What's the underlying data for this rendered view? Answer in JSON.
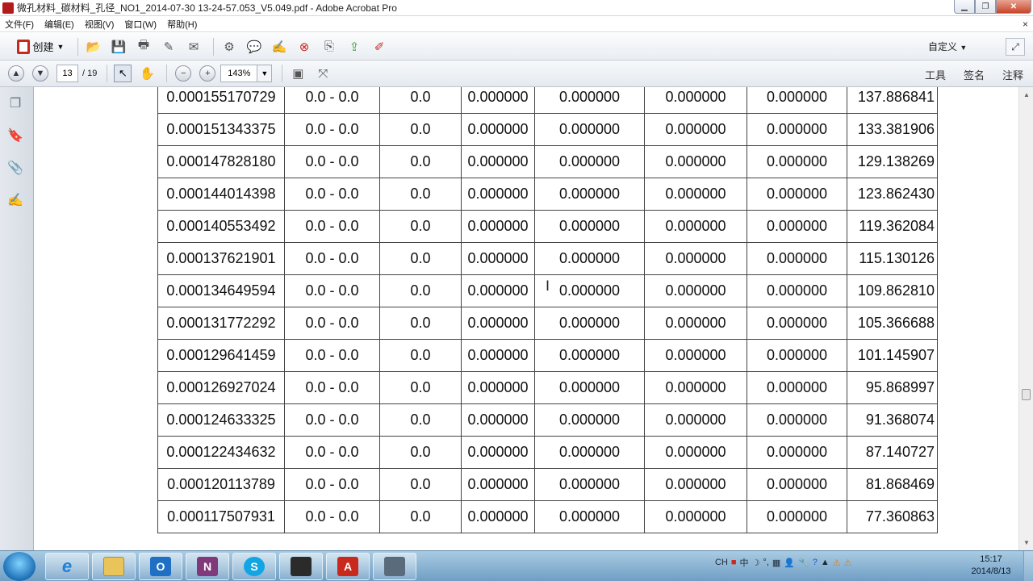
{
  "window": {
    "title": "微孔材料_碳材料_孔径_NO1_2014-07-30 13-24-57.053_V5.049.pdf - Adobe Acrobat Pro"
  },
  "menu": {
    "items": [
      "文件(F)",
      "编辑(E)",
      "视图(V)",
      "窗口(W)",
      "帮助(H)"
    ],
    "close": "×"
  },
  "toolbar": {
    "create_label": "创建",
    "customize_label": "自定义",
    "icons": [
      "open-folder-icon",
      "save-icon",
      "print-icon",
      "edit-icon",
      "email-icon",
      "settings-icon",
      "comment-icon",
      "highlight-icon",
      "stamp-icon",
      "review-icon",
      "share-icon",
      "sign-icon"
    ]
  },
  "navigation": {
    "current_page": "13",
    "total_pages": "/ 19",
    "zoom": "143%",
    "panel_tabs": [
      "工具",
      "签名",
      "注释"
    ]
  },
  "table": {
    "rows": [
      [
        "0.000155170729",
        "0.0 - 0.0",
        "0.0",
        "0.000000",
        "0.000000",
        "0.000000",
        "0.000000",
        "137.886841"
      ],
      [
        "0.000151343375",
        "0.0 - 0.0",
        "0.0",
        "0.000000",
        "0.000000",
        "0.000000",
        "0.000000",
        "133.381906"
      ],
      [
        "0.000147828180",
        "0.0 - 0.0",
        "0.0",
        "0.000000",
        "0.000000",
        "0.000000",
        "0.000000",
        "129.138269"
      ],
      [
        "0.000144014398",
        "0.0 - 0.0",
        "0.0",
        "0.000000",
        "0.000000",
        "0.000000",
        "0.000000",
        "123.862430"
      ],
      [
        "0.000140553492",
        "0.0 - 0.0",
        "0.0",
        "0.000000",
        "0.000000",
        "0.000000",
        "0.000000",
        "119.362084"
      ],
      [
        "0.000137621901",
        "0.0 - 0.0",
        "0.0",
        "0.000000",
        "0.000000",
        "0.000000",
        "0.000000",
        "115.130126"
      ],
      [
        "0.000134649594",
        "0.0 - 0.0",
        "0.0",
        "0.000000",
        "0.000000",
        "0.000000",
        "0.000000",
        "109.862810"
      ],
      [
        "0.000131772292",
        "0.0 - 0.0",
        "0.0",
        "0.000000",
        "0.000000",
        "0.000000",
        "0.000000",
        "105.366688"
      ],
      [
        "0.000129641459",
        "0.0 - 0.0",
        "0.0",
        "0.000000",
        "0.000000",
        "0.000000",
        "0.000000",
        "101.145907"
      ],
      [
        "0.000126927024",
        "0.0 - 0.0",
        "0.0",
        "0.000000",
        "0.000000",
        "0.000000",
        "0.000000",
        "95.868997"
      ],
      [
        "0.000124633325",
        "0.0 - 0.0",
        "0.0",
        "0.000000",
        "0.000000",
        "0.000000",
        "0.000000",
        "91.368074"
      ],
      [
        "0.000122434632",
        "0.0 - 0.0",
        "0.0",
        "0.000000",
        "0.000000",
        "0.000000",
        "0.000000",
        "87.140727"
      ],
      [
        "0.000120113789",
        "0.0 - 0.0",
        "0.0",
        "0.000000",
        "0.000000",
        "0.000000",
        "0.000000",
        "81.868469"
      ],
      [
        "0.000117507931",
        "0.0 - 0.0",
        "0.0",
        "0.000000",
        "0.000000",
        "0.000000",
        "0.000000",
        "77.360863"
      ]
    ]
  },
  "taskbar": {
    "apps": [
      "Internet Explorer",
      "Windows Explorer",
      "Outlook",
      "OneNote",
      "Skype",
      "Video Editor",
      "Adobe Acrobat",
      "Remote Desktop"
    ],
    "app_glyphs": [
      "e",
      "",
      "O",
      "N",
      "S",
      "",
      "A",
      ""
    ],
    "tray_text": [
      "CH",
      "中",
      "☽",
      "°,",
      "▦"
    ],
    "clock_time": "15:17",
    "clock_date": "2014/8/13"
  },
  "colors": {
    "acrobat_red": "#c9281c",
    "taskbar_blue": "#6f9ec4"
  }
}
